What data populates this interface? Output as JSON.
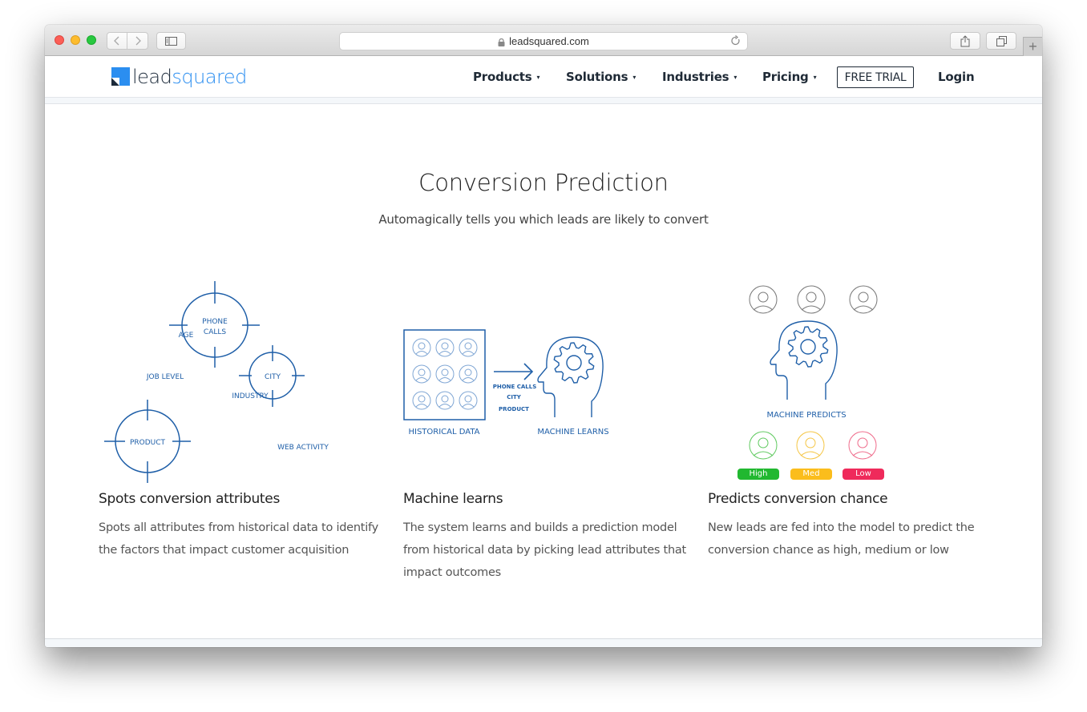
{
  "browser": {
    "url": "leadsquared.com",
    "icons": {
      "back": "chevron-left-icon",
      "forward": "chevron-right-icon",
      "sidebar": "sidebar-icon",
      "lock": "lock-icon",
      "reload": "reload-icon",
      "share": "share-icon",
      "tabs": "tabs-icon",
      "new_tab": "plus-icon"
    },
    "new_tab_label": "+"
  },
  "header": {
    "logo": {
      "part1": "lead",
      "part2": "squared"
    },
    "nav": [
      {
        "label": "Products",
        "caret": "▾"
      },
      {
        "label": "Solutions",
        "caret": "▾"
      },
      {
        "label": "Industries",
        "caret": "▾"
      },
      {
        "label": "Pricing",
        "caret": "▾"
      }
    ],
    "cta": "FREE TRIAL",
    "login": "Login",
    "colors": {
      "brand_blue": "#2b8ef0",
      "brand_dark": "#1c2a3a"
    }
  },
  "section": {
    "title": "Conversion Prediction",
    "subtitle": "Automagically tells you which leads are likely to convert"
  },
  "illustrations": {
    "attributes": {
      "targets": [
        "PHONE",
        "CALLS",
        "CITY",
        "PRODUCT"
      ],
      "labels": [
        "AGE",
        "JOB LEVEL",
        "INDUSTRY",
        "WEB ACTIVITY"
      ]
    },
    "learning": {
      "left_caption": "HISTORICAL DATA",
      "arrow_labels": [
        "PHONE  CALLS",
        "CITY",
        "PRODUCT"
      ],
      "right_caption": "MACHINE LEARNS"
    },
    "predicting": {
      "caption": "MACHINE PREDICTS",
      "badges": [
        {
          "label": "High",
          "color": "#21b830"
        },
        {
          "label": "Med",
          "color": "#fbbd1c"
        },
        {
          "label": "Low",
          "color": "#ef2a5b"
        }
      ]
    },
    "line_color": "#1f5fa8"
  },
  "features": [
    {
      "title": "Spots conversion attributes",
      "desc_lines": [
        "Spots all attributes from historical data to identify",
        "the factors that impact customer acquisition"
      ]
    },
    {
      "title": "Machine learns",
      "desc_lines": [
        "The system learns and builds a prediction model",
        "from historical data by picking lead attributes that",
        "impact outcomes"
      ]
    },
    {
      "title": "Predicts conversion chance",
      "desc_lines": [
        "New leads are fed into the model to predict the",
        "conversion chance as high, medium or low"
      ]
    }
  ]
}
